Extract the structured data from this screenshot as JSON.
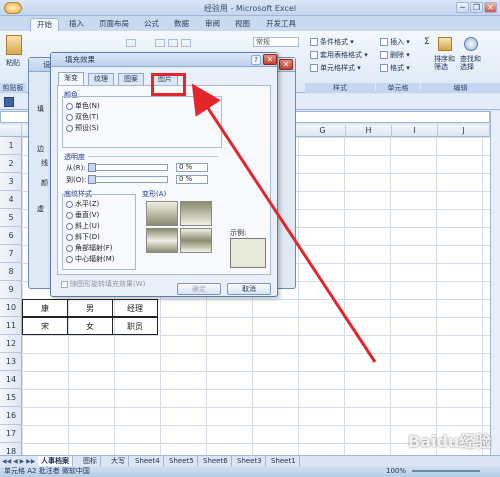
{
  "window": {
    "title": "经验用 - Microsoft Excel",
    "minimize": "─",
    "restore": "❐",
    "close": "✕"
  },
  "tabs": [
    "开始",
    "插入",
    "页面布局",
    "公式",
    "数据",
    "审阅",
    "视图",
    "开发工具"
  ],
  "ribbon": {
    "paste": "粘贴",
    "clipboard": "剪贴板",
    "style_items": [
      "条件格式",
      "套用表格格式",
      "单元格样式"
    ],
    "style_group": "样式",
    "cell_items": [
      "插入",
      "删除",
      "格式"
    ],
    "cell_group": "单元格",
    "edit_sum": "Σ",
    "sort": "排序和\n筛选",
    "find": "查找和\n选择",
    "edit_group": "编辑",
    "number_format": "常规"
  },
  "columns": [
    "G",
    "H",
    "I",
    "J"
  ],
  "rows": [
    "1",
    "2",
    "3",
    "4",
    "5",
    "6",
    "7",
    "8",
    "9",
    "10",
    "11",
    "12",
    "13",
    "14",
    "15",
    "16",
    "17",
    "18"
  ],
  "table_rows": [
    {
      "name": "康",
      "gender": "男",
      "title": "经理"
    },
    {
      "name": "宋",
      "gender": "女",
      "title": "职员"
    }
  ],
  "sheets": [
    "人事档案",
    "图标",
    "大写",
    "Sheet4",
    "Sheet5",
    "Sheet6",
    "Sheet3",
    "Sheet1"
  ],
  "status": {
    "mode": "单元格 A2 批注者 微软中国",
    "zoom": "100%"
  },
  "settings_dialog": {
    "title": "设置",
    "labels": [
      "填",
      "边",
      "线",
      "颜",
      "虚"
    ]
  },
  "fill_dialog": {
    "title": "填充效果",
    "tabs": [
      "渐变",
      "纹理",
      "图案",
      "图片"
    ],
    "color_section": "颜色",
    "color_options": [
      "单色(N)",
      "双色(T)",
      "预设(S)"
    ],
    "transparency_section": "透明度",
    "from_label": "从(R):",
    "to_label": "到(O):",
    "from_value": "0 %",
    "to_value": "0 %",
    "shading_section": "底纹样式",
    "shading_options": [
      "水平(Z)",
      "垂直(V)",
      "斜上(U)",
      "斜下(D)",
      "角部辐射(F)",
      "中心辐射(M)"
    ],
    "variants_section": "变形(A)",
    "sample_label": "示例:",
    "rotate_label": "随图形旋转填充效果(W)",
    "ok": "确定",
    "cancel": "取消",
    "help": "?",
    "close": "✕"
  },
  "watermark": "Baidu经验"
}
